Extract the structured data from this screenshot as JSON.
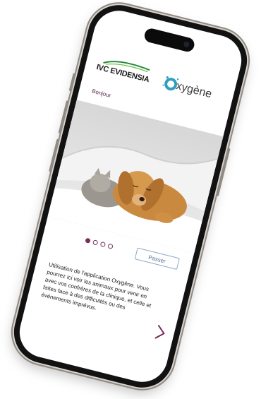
{
  "device": {
    "frame_color": "#121212"
  },
  "header": {
    "left_logo": {
      "text": "IVC EVIDENSIA"
    },
    "right_logo": {
      "text": "xygène",
      "accent_color": "#2f9fc0"
    }
  },
  "greeting": "Bonjour",
  "hero": {
    "icon": "puppy-kitten-sleeping-photo"
  },
  "carousel": {
    "count": 4,
    "active_index": 0
  },
  "actions": {
    "skip_label": "Passer",
    "next_icon": "chevron-right-icon"
  },
  "intro": {
    "text": "Utilisation de l'application Oxygène. Vous pourrez ici voir les animaux pour venir en avec vos confrères de la clinique, et celle et faites face à des difficultés ou des événements imprévus."
  },
  "colors": {
    "brand_plum": "#7a2e5b",
    "skip_border": "#8fa8c9",
    "skip_text": "#4d6f9a"
  }
}
